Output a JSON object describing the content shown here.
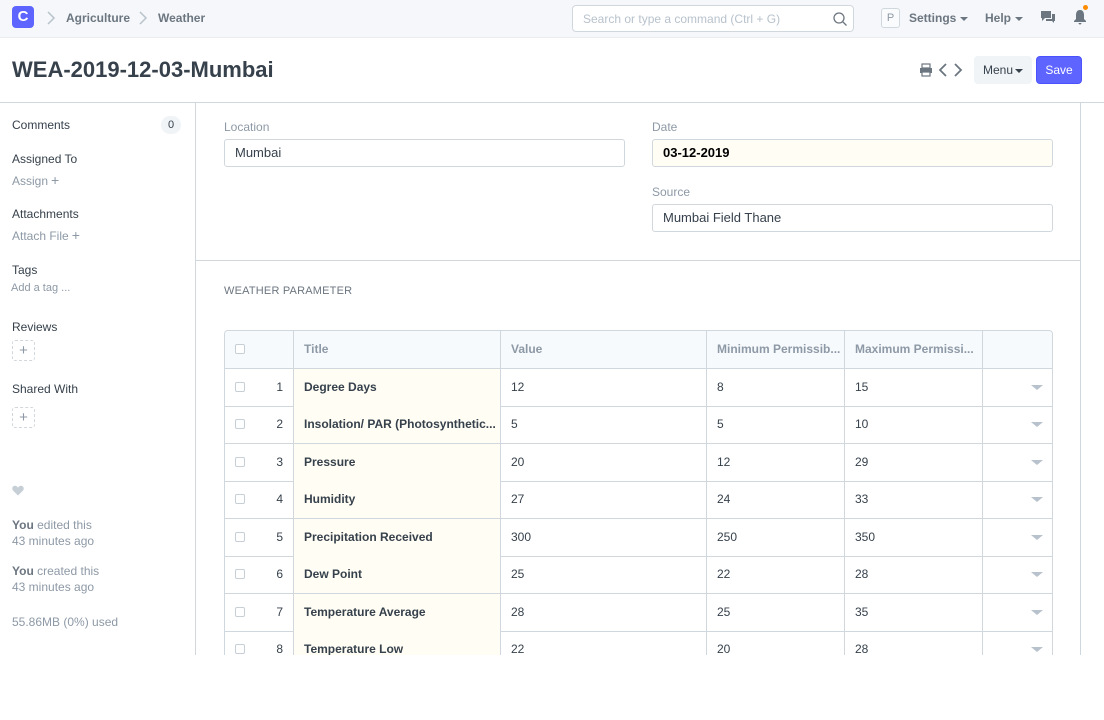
{
  "navbar": {
    "logo_letter": "C",
    "breadcrumbs": [
      "Agriculture",
      "Weather"
    ],
    "search_placeholder": "Search or type a command (Ctrl + G)",
    "avatar_letter": "P",
    "settings_label": "Settings",
    "help_label": "Help",
    "notification_color": "#ff8c00"
  },
  "page": {
    "title": "WEA-2019-12-03-Mumbai",
    "menu_label": "Menu",
    "save_label": "Save",
    "accent_color": "#5e64ff"
  },
  "sidebar": {
    "comments_label": "Comments",
    "comments_count": "0",
    "assigned_label": "Assigned To",
    "assign_link": "Assign",
    "attachments_label": "Attachments",
    "attach_link": "Attach File",
    "tags_label": "Tags",
    "tag_link": "Add a tag ...",
    "reviews_label": "Reviews",
    "shared_label": "Shared With",
    "add_symbol": "+",
    "activity": [
      {
        "who": "You",
        "action": "edited this",
        "when": "43 minutes ago"
      },
      {
        "who": "You",
        "action": "created this",
        "when": "43 minutes ago"
      }
    ],
    "storage": "55.86MB (0%) used"
  },
  "form": {
    "location_label": "Location",
    "location_value": "Mumbai",
    "date_label": "Date",
    "date_value": "03-12-2019",
    "source_label": "Source",
    "source_value": "Mumbai Field Thane",
    "section_title": "WEATHER PARAMETER"
  },
  "table": {
    "headers": [
      "Title",
      "Value",
      "Minimum Permissib...",
      "Maximum Permissi..."
    ],
    "rows": [
      {
        "no": "1",
        "title": "Degree Days",
        "value": "12",
        "min": "8",
        "max": "15"
      },
      {
        "no": "2",
        "title": "Insolation/ PAR (Photosynthetic...",
        "value": "5",
        "min": "5",
        "max": "10"
      },
      {
        "no": "3",
        "title": "Pressure",
        "value": "20",
        "min": "12",
        "max": "29"
      },
      {
        "no": "4",
        "title": "Humidity",
        "value": "27",
        "min": "24",
        "max": "33"
      },
      {
        "no": "5",
        "title": "Precipitation Received",
        "value": "300",
        "min": "250",
        "max": "350"
      },
      {
        "no": "6",
        "title": "Dew Point",
        "value": "25",
        "min": "22",
        "max": "28"
      },
      {
        "no": "7",
        "title": "Temperature Average",
        "value": "28",
        "min": "25",
        "max": "35"
      },
      {
        "no": "8",
        "title": "Temperature Low",
        "value": "22",
        "min": "20",
        "max": "28"
      }
    ]
  }
}
